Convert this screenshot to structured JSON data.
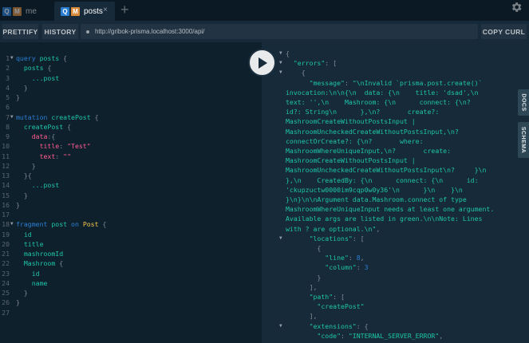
{
  "tabs": [
    {
      "label": "me",
      "badges": [
        "Q",
        "M"
      ],
      "active": false
    },
    {
      "label": "posts",
      "badges": [
        "Q",
        "M"
      ],
      "active": true,
      "close": "×"
    }
  ],
  "add_tab": "+",
  "toolbar": {
    "prettify": "PRETTIFY",
    "history": "HISTORY",
    "url": "http://gribok-prisma.localhost:3000/api/",
    "copy_curl": "COPY CURL"
  },
  "side_tabs": {
    "docs": "DOCS",
    "schema": "SCHEMA"
  },
  "colors": {
    "keyword": "#2a7ed2",
    "field": "#1ec5a8",
    "string": "#ff5d8f",
    "type": "#f5c74d",
    "badge_q": "#2a7ed2",
    "badge_m": "#da8b3a"
  },
  "query_lines": [
    {
      "n": "1",
      "fold": true,
      "tokens": [
        [
          "k",
          "query "
        ],
        [
          "f",
          "posts"
        ],
        [
          "p",
          " {"
        ]
      ]
    },
    {
      "n": "2",
      "fold": false,
      "tokens": [
        [
          "f",
          "  posts"
        ],
        [
          "p",
          " {"
        ]
      ]
    },
    {
      "n": "3",
      "fold": false,
      "tokens": [
        [
          "p",
          "    "
        ],
        [
          "f",
          "...post"
        ]
      ]
    },
    {
      "n": "4",
      "fold": false,
      "tokens": [
        [
          "p",
          "  }"
        ]
      ]
    },
    {
      "n": "5",
      "fold": false,
      "tokens": [
        [
          "p",
          "}"
        ]
      ]
    },
    {
      "n": "6",
      "fold": false,
      "tokens": []
    },
    {
      "n": "7",
      "fold": true,
      "tokens": [
        [
          "k",
          "mutation "
        ],
        [
          "f",
          "createPost"
        ],
        [
          "p",
          " {"
        ]
      ]
    },
    {
      "n": "8",
      "fold": false,
      "tokens": [
        [
          "f",
          "  createPost"
        ],
        [
          "p",
          " {"
        ]
      ]
    },
    {
      "n": "9",
      "fold": false,
      "tokens": [
        [
          "s",
          "    data"
        ],
        [
          "p",
          ":{"
        ]
      ]
    },
    {
      "n": "10",
      "fold": false,
      "tokens": [
        [
          "s",
          "      title"
        ],
        [
          "p",
          ": "
        ],
        [
          "s",
          "\"Test\""
        ]
      ]
    },
    {
      "n": "11",
      "fold": false,
      "tokens": [
        [
          "s",
          "      text"
        ],
        [
          "p",
          ": "
        ],
        [
          "s",
          "\"\""
        ]
      ]
    },
    {
      "n": "12",
      "fold": false,
      "tokens": [
        [
          "p",
          "    }"
        ]
      ]
    },
    {
      "n": "13",
      "fold": false,
      "tokens": [
        [
          "p",
          "  }{"
        ]
      ]
    },
    {
      "n": "14",
      "fold": false,
      "tokens": [
        [
          "p",
          "    "
        ],
        [
          "f",
          "...post"
        ]
      ]
    },
    {
      "n": "15",
      "fold": false,
      "tokens": [
        [
          "p",
          "  }"
        ]
      ]
    },
    {
      "n": "16",
      "fold": false,
      "tokens": [
        [
          "p",
          "}"
        ]
      ]
    },
    {
      "n": "17",
      "fold": false,
      "tokens": []
    },
    {
      "n": "18",
      "fold": true,
      "tokens": [
        [
          "k",
          "fragment "
        ],
        [
          "f",
          "post"
        ],
        [
          "k",
          " on "
        ],
        [
          "ty",
          "Post"
        ],
        [
          "p",
          " {"
        ]
      ]
    },
    {
      "n": "19",
      "fold": false,
      "tokens": [
        [
          "f",
          "  id"
        ]
      ]
    },
    {
      "n": "20",
      "fold": false,
      "tokens": [
        [
          "f",
          "  title"
        ]
      ]
    },
    {
      "n": "21",
      "fold": false,
      "tokens": [
        [
          "f",
          "  mashroomId"
        ]
      ]
    },
    {
      "n": "22",
      "fold": false,
      "tokens": [
        [
          "f",
          "  Mashroom"
        ],
        [
          "p",
          " {"
        ]
      ]
    },
    {
      "n": "23",
      "fold": false,
      "tokens": [
        [
          "f",
          "    id"
        ]
      ]
    },
    {
      "n": "24",
      "fold": false,
      "tokens": [
        [
          "f",
          "    name"
        ]
      ]
    },
    {
      "n": "25",
      "fold": false,
      "tokens": [
        [
          "p",
          "  }"
        ]
      ]
    },
    {
      "n": "26",
      "fold": false,
      "tokens": [
        [
          "p",
          "}"
        ]
      ]
    },
    {
      "n": "27",
      "fold": false,
      "tokens": []
    }
  ],
  "result_lines": [
    {
      "fold": true,
      "tokens": [
        [
          "rp",
          "{"
        ]
      ]
    },
    {
      "fold": true,
      "tokens": [
        [
          "rk",
          "  \"errors\""
        ],
        [
          "rp",
          ": ["
        ]
      ]
    },
    {
      "fold": true,
      "tokens": [
        [
          "rp",
          "    {"
        ]
      ]
    },
    {
      "fold": false,
      "tokens": [
        [
          "rk",
          "      \"message\""
        ],
        [
          "rp",
          ": "
        ],
        [
          "rs",
          "\"\\nInvalid `prisma.post.create()`"
        ]
      ]
    },
    {
      "fold": false,
      "tokens": [
        [
          "rs",
          "invocation:\\n\\n{\\n  data: {\\n    title: 'dsad',\\n"
        ]
      ]
    },
    {
      "fold": false,
      "tokens": [
        [
          "rs",
          "text: '',\\n    Mashroom: {\\n      connect: {\\n?"
        ]
      ]
    },
    {
      "fold": false,
      "tokens": [
        [
          "rs",
          "id?: String\\n      },\\n?       create?:"
        ]
      ]
    },
    {
      "fold": false,
      "tokens": [
        [
          "rs",
          "MashroomCreateWithoutPostsInput |"
        ]
      ]
    },
    {
      "fold": false,
      "tokens": [
        [
          "rs",
          "MashroomUncheckedCreateWithoutPostsInput,\\n?"
        ]
      ]
    },
    {
      "fold": false,
      "tokens": [
        [
          "rs",
          "connectOrCreate?: {\\n?       where:"
        ]
      ]
    },
    {
      "fold": false,
      "tokens": [
        [
          "rs",
          "MashroomWhereUniqueInput,\\n?       create:"
        ]
      ]
    },
    {
      "fold": false,
      "tokens": [
        [
          "rs",
          "MashroomCreateWithoutPostsInput |"
        ]
      ]
    },
    {
      "fold": false,
      "tokens": [
        [
          "rs",
          "MashroomUncheckedCreateWithoutPostsInput\\n?     }\\n"
        ]
      ]
    },
    {
      "fold": false,
      "tokens": [
        [
          "rs",
          "},\\n    CreatedBy: {\\n      connect: {\\n      id:"
        ]
      ]
    },
    {
      "fold": false,
      "tokens": [
        [
          "rs",
          "'ckupzuctw0000im9cqp0w0y36'\\n      }\\n    }\\n"
        ]
      ]
    },
    {
      "fold": false,
      "tokens": [
        [
          "rs",
          "}\\n}\\n\\nArgument data.Mashroom.connect of type"
        ]
      ]
    },
    {
      "fold": false,
      "tokens": [
        [
          "rs",
          "MashroomWhereUniqueInput needs at least one argument."
        ]
      ]
    },
    {
      "fold": false,
      "tokens": [
        [
          "rs",
          "Available args are listed in green.\\n\\nNote: Lines"
        ]
      ]
    },
    {
      "fold": false,
      "tokens": [
        [
          "rs",
          "with ? are optional.\\n\""
        ],
        [
          "rp",
          ","
        ]
      ]
    },
    {
      "fold": true,
      "tokens": [
        [
          "rk",
          "      \"locations\""
        ],
        [
          "rp",
          ": ["
        ]
      ]
    },
    {
      "fold": false,
      "tokens": [
        [
          "rp",
          "        {"
        ]
      ]
    },
    {
      "fold": false,
      "tokens": [
        [
          "rk",
          "          \"line\""
        ],
        [
          "rp",
          ": "
        ],
        [
          "rn",
          "8"
        ],
        [
          "rp",
          ","
        ]
      ]
    },
    {
      "fold": false,
      "tokens": [
        [
          "rk",
          "          \"column\""
        ],
        [
          "rp",
          ": "
        ],
        [
          "rn",
          "3"
        ]
      ]
    },
    {
      "fold": false,
      "tokens": [
        [
          "rp",
          "        }"
        ]
      ]
    },
    {
      "fold": false,
      "tokens": [
        [
          "rp",
          "      ],"
        ]
      ]
    },
    {
      "fold": false,
      "tokens": [
        [
          "rk",
          "      \"path\""
        ],
        [
          "rp",
          ": ["
        ]
      ]
    },
    {
      "fold": false,
      "tokens": [
        [
          "rs",
          "        \"createPost\""
        ]
      ]
    },
    {
      "fold": false,
      "tokens": [
        [
          "rp",
          "      ],"
        ]
      ]
    },
    {
      "fold": true,
      "tokens": [
        [
          "rk",
          "      \"extensions\""
        ],
        [
          "rp",
          ": {"
        ]
      ]
    },
    {
      "fold": false,
      "tokens": [
        [
          "rk",
          "        \"code\""
        ],
        [
          "rp",
          ": "
        ],
        [
          "rs",
          "\"INTERNAL_SERVER_ERROR\""
        ],
        [
          "rp",
          ","
        ]
      ]
    }
  ]
}
